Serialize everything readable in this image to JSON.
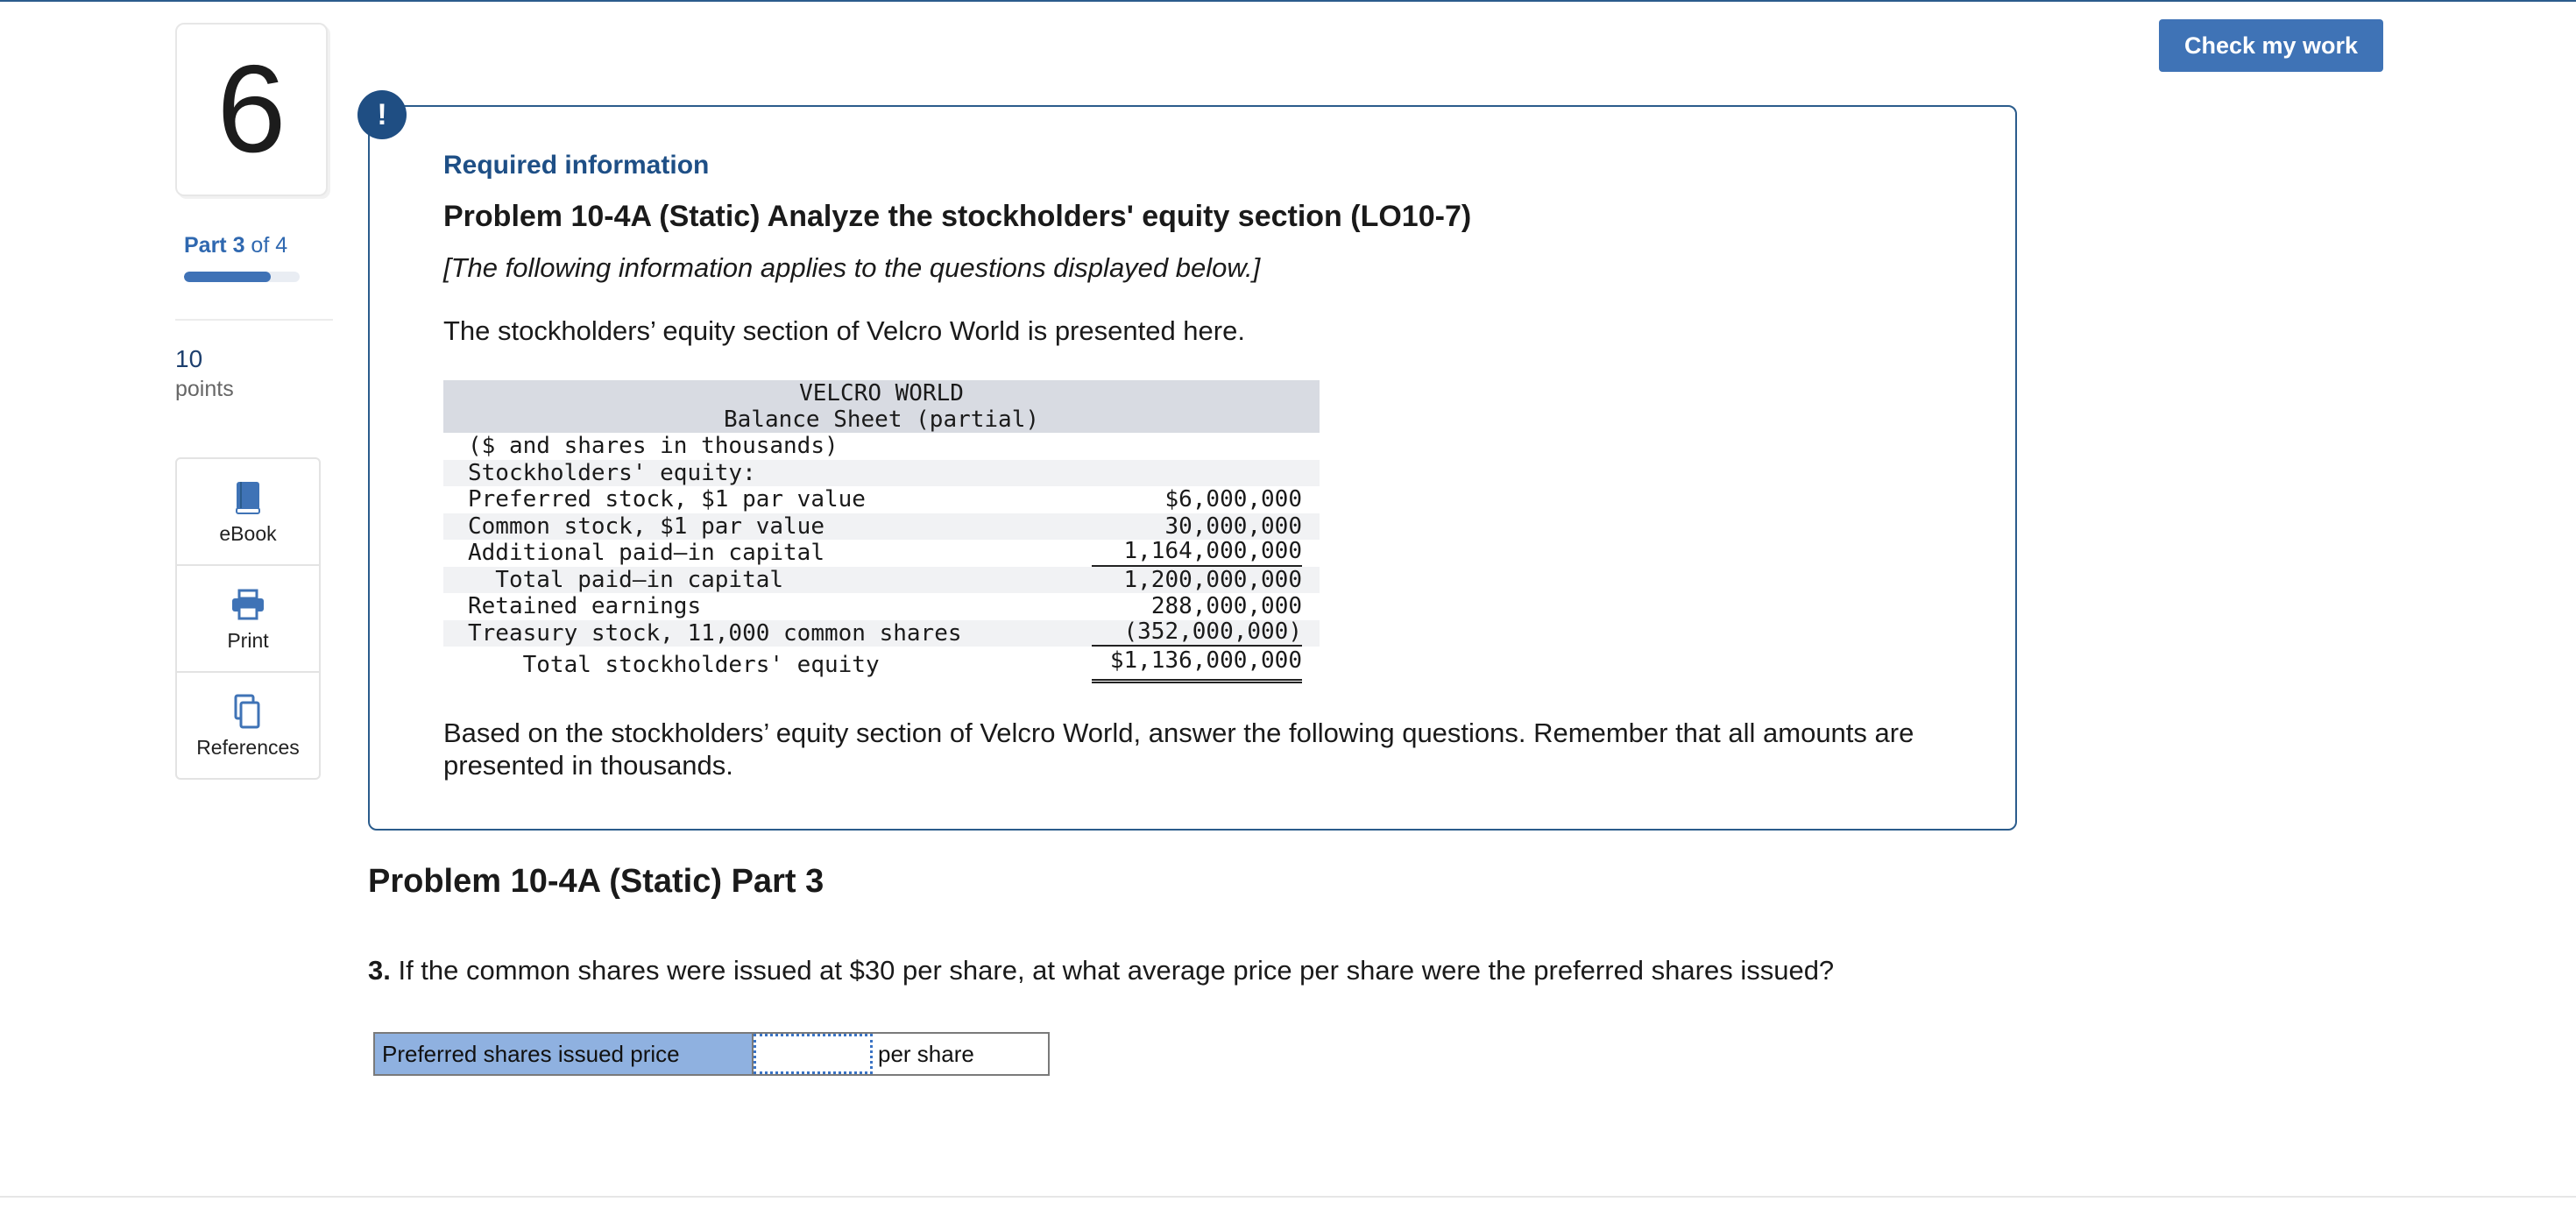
{
  "question_number": "6",
  "part": {
    "bold": "Part 3",
    "rest": " of 4",
    "progress_fraction": 0.75
  },
  "points": {
    "value": "10",
    "label": "points"
  },
  "tools": [
    {
      "label": "eBook",
      "icon": "book-icon"
    },
    {
      "label": "Print",
      "icon": "printer-icon"
    },
    {
      "label": "References",
      "icon": "documents-icon"
    }
  ],
  "check_button": "Check my work",
  "info": {
    "heading": "Required information",
    "title": "Problem 10-4A (Static) Analyze the stockholders' equity section (LO10-7)",
    "applies": "[The following information applies to the questions displayed below.]",
    "intro": "The stockholders’ equity section of Velcro World is presented here.",
    "balance_sheet": {
      "company": "VELCRO WORLD",
      "statement": "Balance Sheet (partial)",
      "rows": [
        {
          "label": "($ and shares in thousands)",
          "amount": ""
        },
        {
          "label": "Stockholders' equity:",
          "amount": ""
        },
        {
          "label": "Preferred stock, $1 par value",
          "amount": "$6,000,000"
        },
        {
          "label": "Common stock, $1 par value",
          "amount": "30,000,000"
        },
        {
          "label": "Additional paid–in capital",
          "amount": "1,164,000,000"
        },
        {
          "label": "  Total paid–in capital",
          "amount": "1,200,000,000"
        },
        {
          "label": "Retained earnings",
          "amount": "288,000,000"
        },
        {
          "label": "Treasury stock, 11,000 common shares",
          "amount": "(352,000,000)"
        },
        {
          "label": "    Total stockholders' equity",
          "amount": "$1,136,000,000"
        }
      ]
    },
    "closing": "Based on the stockholders’ equity section of Velcro World, answer the following questions. Remember that all amounts are presented in thousands."
  },
  "part_title": "Problem 10-4A (Static) Part 3",
  "question": {
    "number": "3.",
    "text": " If the common shares were issued at $30 per share, at what average price per share were the preferred shares issued?"
  },
  "answer": {
    "label": "Preferred shares issued price",
    "value": "",
    "unit": "per share"
  }
}
